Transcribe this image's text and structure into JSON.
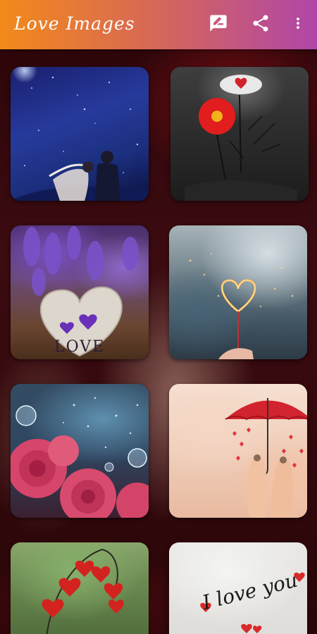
{
  "app": {
    "title": "Love Images",
    "accent_start": "#f28a1a",
    "accent_end": "#b046a8"
  },
  "toolbar": {
    "actions": [
      {
        "icon": "rate-review-icon"
      },
      {
        "icon": "share-icon"
      },
      {
        "icon": "more-vert-icon"
      }
    ]
  },
  "grid": {
    "items": [
      {
        "icon": "couple-night-sky-image"
      },
      {
        "icon": "red-flower-image"
      },
      {
        "icon": "lavender-heart-image",
        "text": "LOVE"
      },
      {
        "icon": "sparkler-heart-image"
      },
      {
        "icon": "roses-bubbles-image"
      },
      {
        "icon": "umbrella-fingers-image"
      },
      {
        "icon": "hanging-hearts-image"
      },
      {
        "icon": "paper-love-you-image",
        "text": "I love you"
      }
    ]
  }
}
